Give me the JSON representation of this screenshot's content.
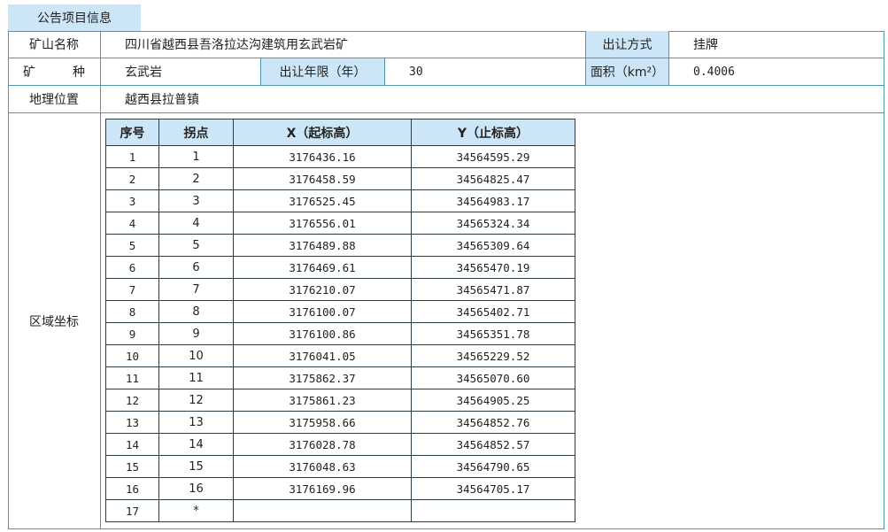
{
  "header": {
    "tab_label": "公告项目信息"
  },
  "info": {
    "mine_name_label": "矿山名称",
    "mine_name_value": "四川省越西县吾洛拉达沟建筑用玄武岩矿",
    "transfer_method_label": "出让方式",
    "transfer_method_value": "挂牌",
    "mineral_label": "矿　　　种",
    "mineral_value": "玄武岩",
    "term_label": "出让年限（年）",
    "term_value": "30",
    "area_label": "面积（km²）",
    "area_value": "0.4006",
    "location_label": "地理位置",
    "location_value": "越西县拉普镇",
    "coords_label": "区域坐标"
  },
  "coords_table": {
    "headers": [
      "序号",
      "拐点",
      "X（起标高）",
      "Y（止标高）"
    ],
    "rows": [
      [
        "1",
        "1",
        "3176436.16",
        "34564595.29"
      ],
      [
        "2",
        "2",
        "3176458.59",
        "34564825.47"
      ],
      [
        "3",
        "3",
        "3176525.45",
        "34564983.17"
      ],
      [
        "4",
        "4",
        "3176556.01",
        "34565324.34"
      ],
      [
        "5",
        "5",
        "3176489.88",
        "34565309.64"
      ],
      [
        "6",
        "6",
        "3176469.61",
        "34565470.19"
      ],
      [
        "7",
        "7",
        "3176210.07",
        "34565471.87"
      ],
      [
        "8",
        "8",
        "3176100.07",
        "34565402.71"
      ],
      [
        "9",
        "9",
        "3176100.86",
        "34565351.78"
      ],
      [
        "10",
        "10",
        "3176041.05",
        "34565229.52"
      ],
      [
        "11",
        "11",
        "3175862.37",
        "34565070.60"
      ],
      [
        "12",
        "12",
        "3175861.23",
        "34564905.25"
      ],
      [
        "13",
        "13",
        "3175958.66",
        "34564852.76"
      ],
      [
        "14",
        "14",
        "3176028.78",
        "34564852.57"
      ],
      [
        "15",
        "15",
        "3176048.63",
        "34564790.65"
      ],
      [
        "16",
        "16",
        "3176169.96",
        "34564705.17"
      ],
      [
        "17",
        "*",
        "",
        ""
      ]
    ]
  }
}
